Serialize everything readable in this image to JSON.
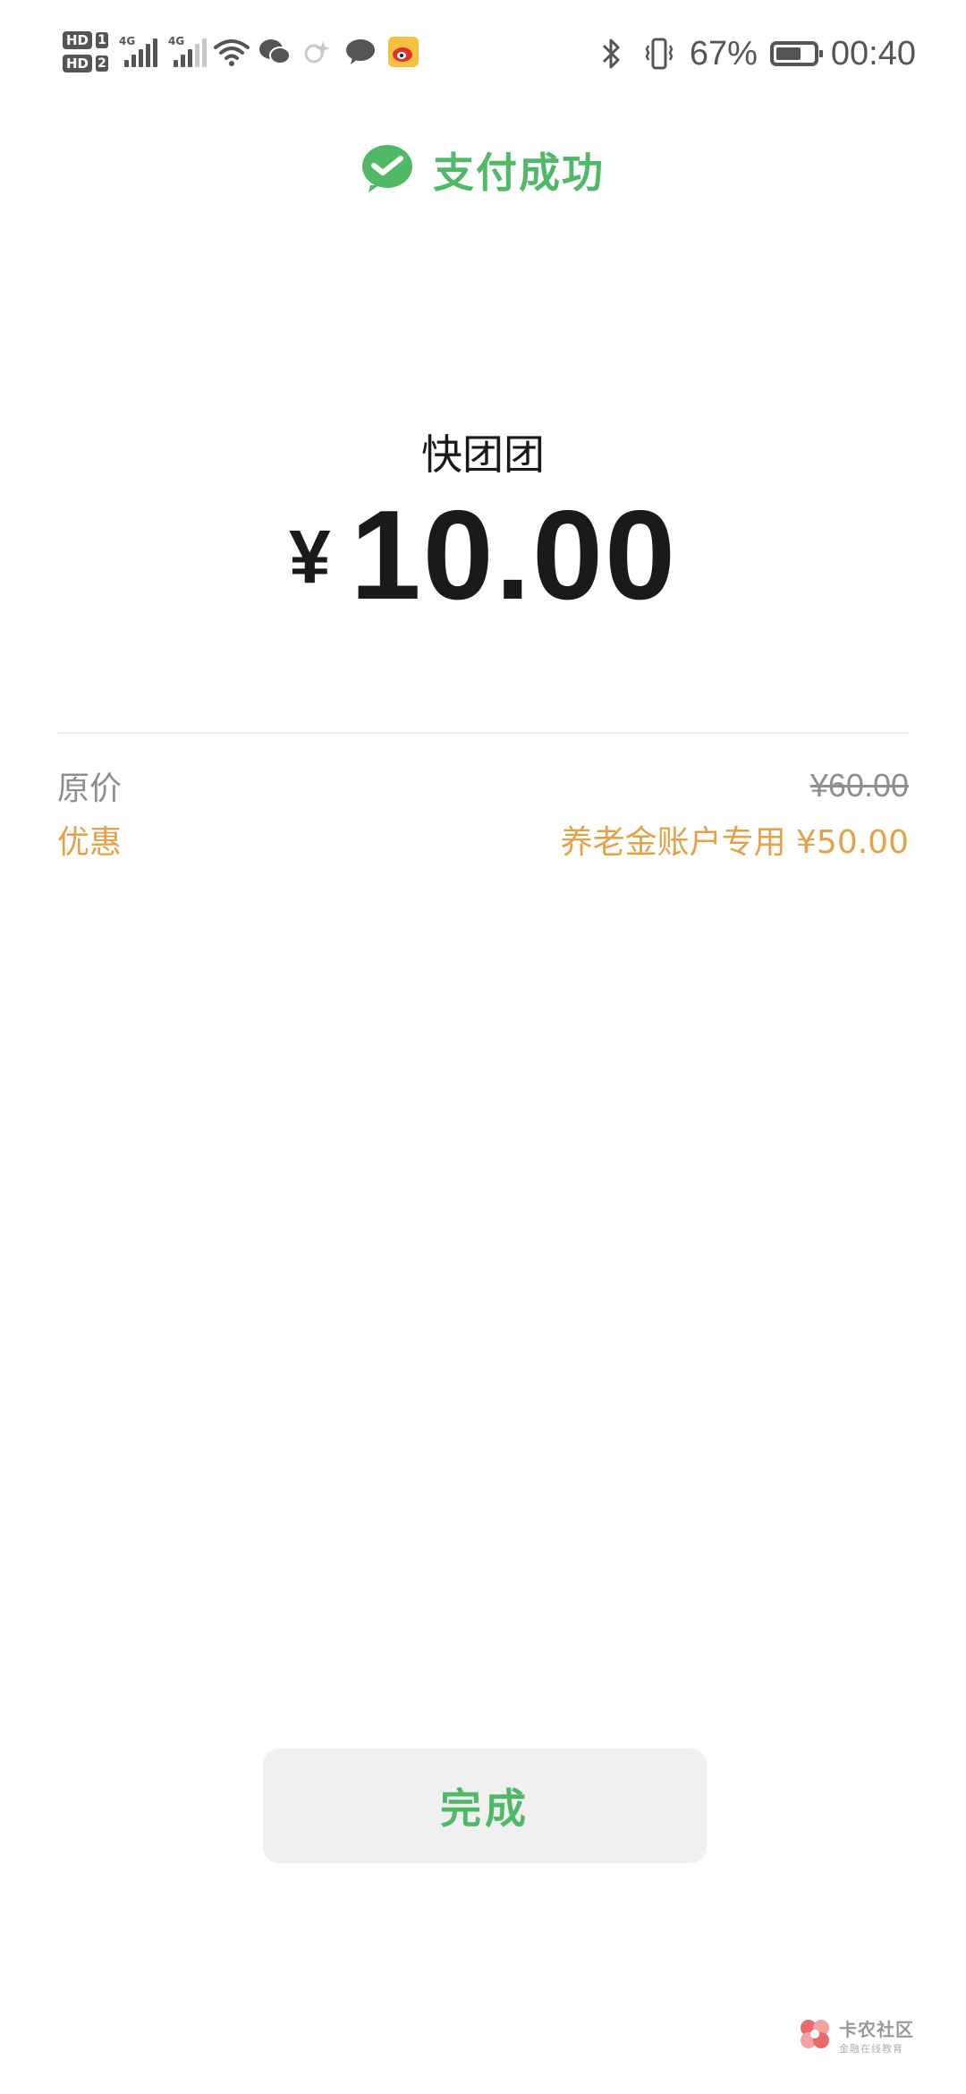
{
  "status_bar": {
    "sim1_hd": "HD",
    "sim1_num": "1",
    "sim2_hd": "HD",
    "sim2_num": "2",
    "net1": "4G",
    "net2": "4G",
    "battery_percent": "67%",
    "battery_level": 0.67,
    "time": "00:40",
    "icons": [
      "wifi-icon",
      "wechat-icon",
      "sparkle-icon",
      "message-icon",
      "weibo-icon",
      "bluetooth-icon",
      "vibrate-icon",
      "battery-icon"
    ]
  },
  "header": {
    "title": "支付成功",
    "icon": "wechat-pay-icon",
    "accent_color": "#4fb967"
  },
  "payment": {
    "merchant": "快团团",
    "currency_symbol": "¥",
    "amount": "10.00"
  },
  "details": {
    "original_label": "原价",
    "original_value": "¥60.00",
    "discount_label": "优惠",
    "discount_value": "养老金账户专用 ¥50.00",
    "discount_color": "#e3a247"
  },
  "actions": {
    "done_label": "完成"
  },
  "watermark": {
    "main": "卡农社区",
    "sub": "金融在线教育"
  }
}
